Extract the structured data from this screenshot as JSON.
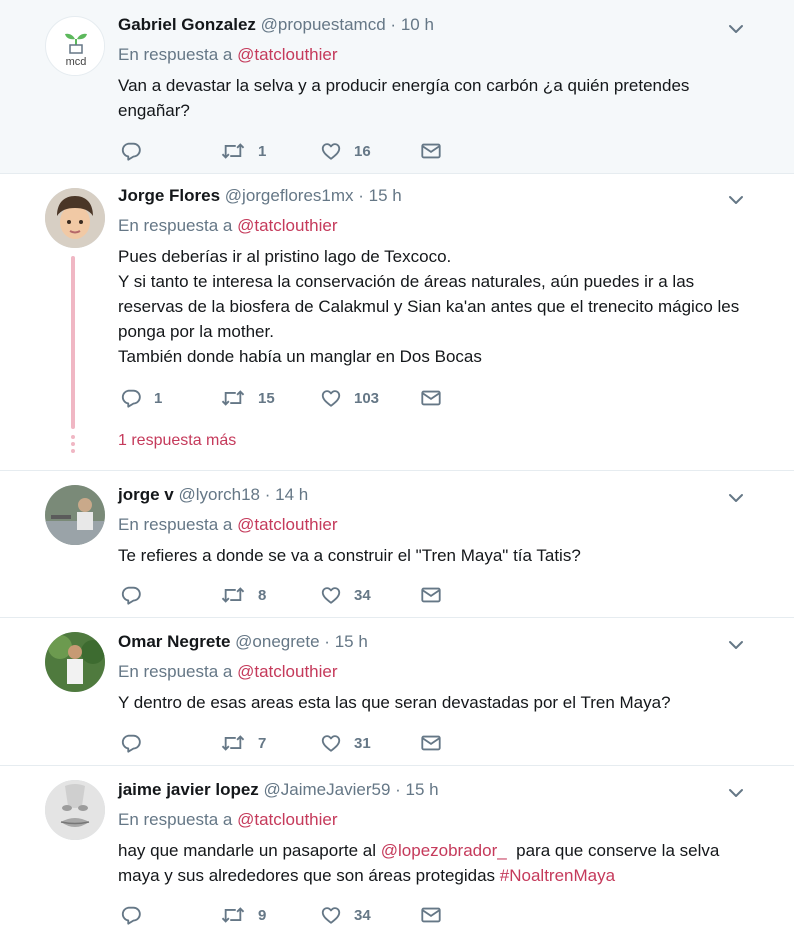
{
  "tweets": [
    {
      "name": "Gabriel Gonzalez",
      "handle": "@propuestamcd",
      "time": "10 h",
      "reply_prefix": "En respuesta a",
      "reply_to": "@tatclouthier",
      "lines": [
        "Van a devastar la selva y a producir energía con carbón ¿a quién pretendes",
        "engañar?"
      ],
      "retweets": "1",
      "likes": "16",
      "avatar_text": "mcd"
    },
    {
      "name": "Jorge Flores",
      "handle": "@jorgeflores1mx",
      "time": "15 h",
      "reply_prefix": "En respuesta a",
      "reply_to": "@tatclouthier",
      "lines": [
        "Pues deberías ir al pristino lago de Texcoco.",
        "Y si tanto te interesa la conservación de áreas naturales, aún puedes ir a las",
        "reservas de la biosfera de Calakmul y Sian ka'an antes que el trenecito mágico les",
        "ponga por la mother.",
        "También donde había un manglar en Dos Bocas"
      ],
      "replies": "1",
      "retweets": "15",
      "likes": "103",
      "more_replies": "1 respuesta más"
    },
    {
      "name": "jorge v",
      "handle": "@lyorch18",
      "time": "14 h",
      "reply_prefix": "En respuesta a",
      "reply_to": "@tatclouthier",
      "lines": [
        "Te refieres a donde se va a construir el \"Tren Maya\" tía Tatis?"
      ],
      "retweets": "8",
      "likes": "34"
    },
    {
      "name": "Omar Negrete",
      "handle": "@onegrete",
      "time": "15 h",
      "reply_prefix": "En respuesta a",
      "reply_to": "@tatclouthier",
      "lines": [
        "Y dentro de esas areas esta las que seran devastadas por el Tren Maya?"
      ],
      "retweets": "7",
      "likes": "31"
    },
    {
      "name": "jaime javier lopez",
      "handle": "@JaimeJavier59",
      "time": "15 h",
      "reply_prefix": "En respuesta a",
      "reply_to": "@tatclouthier",
      "line1_pre": "hay que mandarle un pasaporte al ",
      "line1_link": "@lopezobrador_",
      "line1_post": "  para que conserve la selva",
      "line2_pre": "maya y sus alrededores que son áreas protegidas ",
      "line2_link": "#NoaltrenMaya",
      "retweets": "9",
      "likes": "34"
    }
  ],
  "separator": "·",
  "colors": {
    "link": "#c53a5b",
    "muted": "#657786",
    "thread": "#f0b7c4",
    "highlight_bg": "#f5f8fa"
  },
  "icons": [
    "reply-icon",
    "retweet-icon",
    "like-icon",
    "message-icon",
    "chevron-down-icon"
  ]
}
